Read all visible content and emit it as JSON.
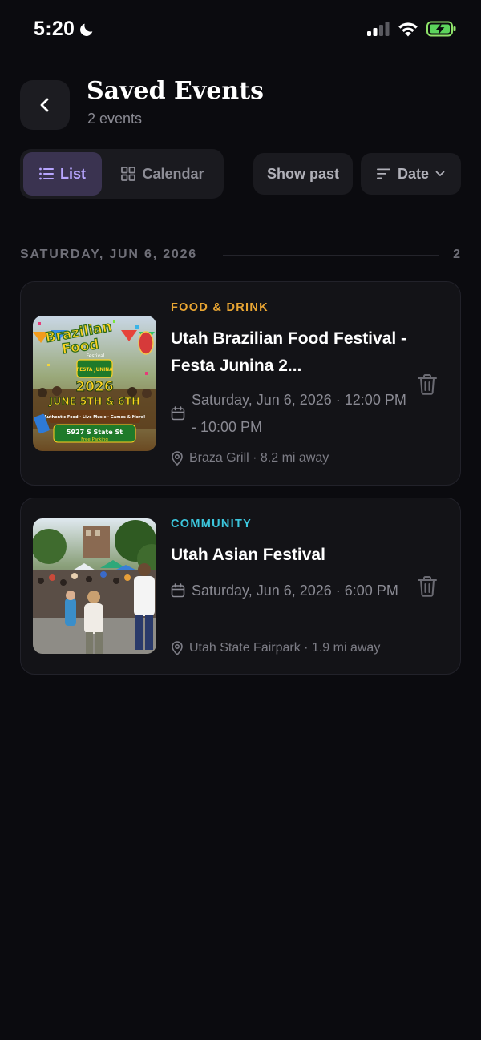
{
  "status_bar": {
    "time": "5:20",
    "icons": [
      "moon-icon",
      "signal-icon",
      "wifi-icon",
      "battery-charging-icon"
    ]
  },
  "header": {
    "back_icon": "chevron-left-icon",
    "title": "Saved Events",
    "subtitle": "2 events"
  },
  "toolbar": {
    "view_list_label": "List",
    "view_calendar_label": "Calendar",
    "show_past_label": "Show past",
    "sort_label": "Date",
    "active_view": "List"
  },
  "section": {
    "date": "SATURDAY, JUN 6, 2026",
    "count": "2"
  },
  "events": [
    {
      "category": "FOOD & DRINK",
      "category_color": "#e8a533",
      "title": "Utah Brazilian Food Festival - Festa Junina 2...",
      "when": "Saturday, Jun 6, 2026 · 12:00 PM - 10:00 PM",
      "where": "Braza Grill · 8.2 mi away",
      "poster": {
        "line1": "Brazilian",
        "line2": "Food",
        "line3": "Festival",
        "badge": "FESTA JUNINA",
        "year": "2026",
        "dates": "JUNE 5TH & 6TH",
        "features": "Authentic Food · Live Music · Games & More!",
        "address": "5927 S State St",
        "parking": "Free Parking"
      }
    },
    {
      "category": "COMMUNITY",
      "category_color": "#3cc6dd",
      "title": "Utah Asian Festival",
      "when": "Saturday, Jun 6, 2026 · 6:00 PM",
      "where": "Utah State Fairpark · 1.9 mi away"
    }
  ]
}
